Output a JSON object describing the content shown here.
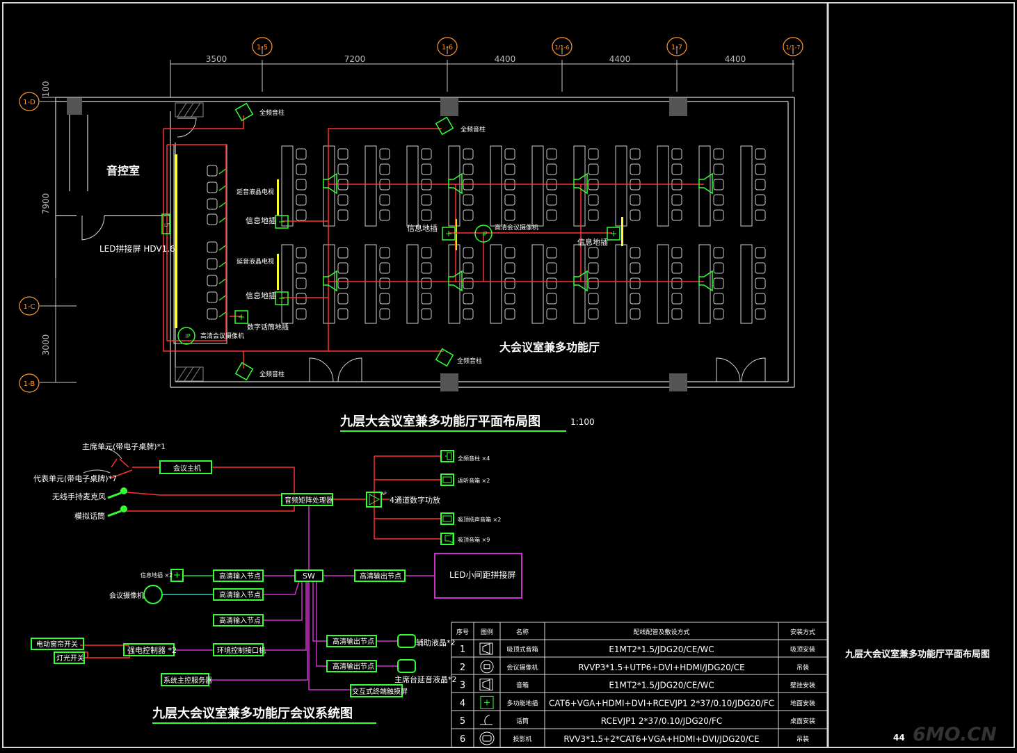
{
  "grid": {
    "top_axes": [
      "1-5",
      "1-6",
      "1/1-6",
      "1-7",
      "1/1-7"
    ],
    "left_axes": [
      "1-D",
      "1-C",
      "1-B"
    ],
    "top_dims": [
      "3500",
      "7200",
      "4400",
      "4400",
      "4400"
    ],
    "left_dims": [
      "100",
      "7900",
      "3000"
    ]
  },
  "plan": {
    "room_control": "音控室",
    "room_main": "大会议室兼多功能厅",
    "led_label": "LED拼接屏 HDV1.6",
    "speaker_full_1": "全频音柱",
    "speaker_full_2": "全频音柱",
    "speaker_full_3": "全频音柱",
    "speaker_full_4": "全频音柱",
    "lcd_delay_1": "延音液晶电视",
    "lcd_delay_2": "延音液晶电视",
    "floor_box_1": "信息地插",
    "floor_box_2": "信息地插",
    "floor_box_3": "信息地插",
    "floor_box_4": "信息地插",
    "camera_1": "高清会议摄像机",
    "camera_2": "高清会议摄像机",
    "digital_floor": "数字话筒地插",
    "lf": "LF",
    "title": "九层大会议室兼多功能厅平面布局图",
    "scale": "1:100"
  },
  "system": {
    "chair_unit": "主席单元(带电子桌牌)*1",
    "delegate_unit": "代表单元(带电子桌牌)*7",
    "wireless_mic": "无线手持麦克风",
    "analog_mic": "模拟话筒",
    "conf_host": "会议主机",
    "audio_matrix": "音频矩阵处理器",
    "amp": "4通道数字功放",
    "amp_sym": "AP",
    "out_1": "全频音柱 ×4",
    "out_2": "返听音箱 ×2",
    "out_3": "吸顶扬声音箱 ×2",
    "out_4": "吸顶音箱 ×9",
    "info_floor": "信息地插 ×2",
    "conf_camera": "会议摄像机",
    "hd_in_1": "高清输入节点",
    "hd_in_2": "高清输入节点",
    "hd_in_3": "高清输入节点",
    "sw": "SW",
    "hd_out_1": "高清输出节点",
    "hd_out_2": "高清输出节点",
    "hd_out_3": "高清输出节点",
    "led_screen": "LED小间距拼接屏",
    "lcd_aux": "辅助液晶*2",
    "lcd_podium": "主席台延音液晶*2",
    "curtain_switch": "电动窗帘开关",
    "light_switch": "灯光开关",
    "relay": "强电控制器 *2",
    "env_ctrl": "环境控制接口机",
    "sys_server": "系统主控服务器",
    "touch_panel": "交互式终端触摸屏",
    "title": "九层大会议室兼多功能厅会议系统图"
  },
  "legend": {
    "headers": [
      "序号",
      "图例",
      "名称",
      "配线配管及敷设方式",
      "安装方式"
    ],
    "rows": [
      {
        "no": "1",
        "name": "吸顶式音箱",
        "spec": "E1MT2*1.5/JDG20/CE/WC",
        "install": "吸顶安装",
        "icon": "ceiling-speaker-icon"
      },
      {
        "no": "2",
        "name": "会议摄像机",
        "spec": "RVVP3*1.5+UTP6+DVI+HDMI/JDG20/CE",
        "install": "吊装",
        "icon": "camera-icon"
      },
      {
        "no": "3",
        "name": "音箱",
        "spec": "E1MT2*1.5/JDG20/CE/WC",
        "install": "壁挂安装",
        "icon": "speaker-icon"
      },
      {
        "no": "4",
        "name": "多功能地插",
        "spec": "CAT6+VGA+HDMI+DVI+RCEVJP1 2*37/0.10/JDG20/FC",
        "install": "地面安装",
        "icon": "floor-box-icon"
      },
      {
        "no": "5",
        "name": "话筒",
        "spec": "RCEVJP1 2*37/0.10/JDG20/FC",
        "install": "桌面安装",
        "icon": "microphone-icon"
      },
      {
        "no": "6",
        "name": "投影机",
        "spec": "RVV3*1.5+2*CAT6+VGA+HDMI+DVI/JDG20/CE",
        "install": "吊装",
        "icon": "projector-icon"
      }
    ]
  },
  "sidebar": {
    "title": "九层大会议室兼多功能厅平面布局图",
    "page": "44"
  },
  "watermark": "6MO.CN",
  "colors": {
    "red": "#ff3030",
    "green": "#33ff33",
    "magenta": "#cc33cc",
    "cyan": "#33cccc",
    "yellow": "#ffff33",
    "white": "#ffffff",
    "frame": "#d8d8d8"
  }
}
